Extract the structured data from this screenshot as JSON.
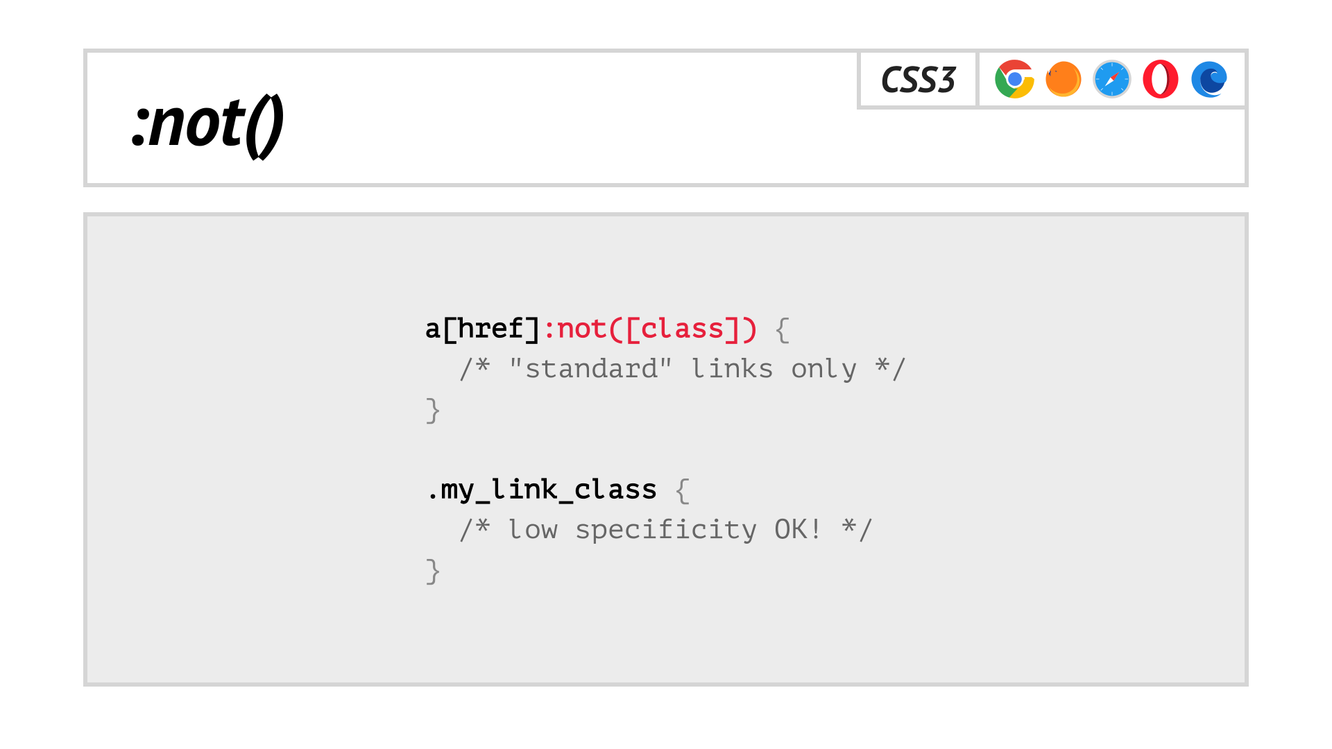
{
  "header": {
    "title": ":not()",
    "spec_label": "CSS3",
    "browsers": [
      "chrome",
      "firefox",
      "safari",
      "opera",
      "edge"
    ]
  },
  "code": {
    "rule1": {
      "sel_prefix": "a[href]",
      "sel_not": ":not([class])",
      "open_brace": " {",
      "comment": "  /* \"standard\" links only */",
      "close_brace": "}"
    },
    "rule2": {
      "selector": ".my_link_class",
      "open_brace": " {",
      "comment": "  /* low specificity OK! */",
      "close_brace": "}"
    }
  }
}
